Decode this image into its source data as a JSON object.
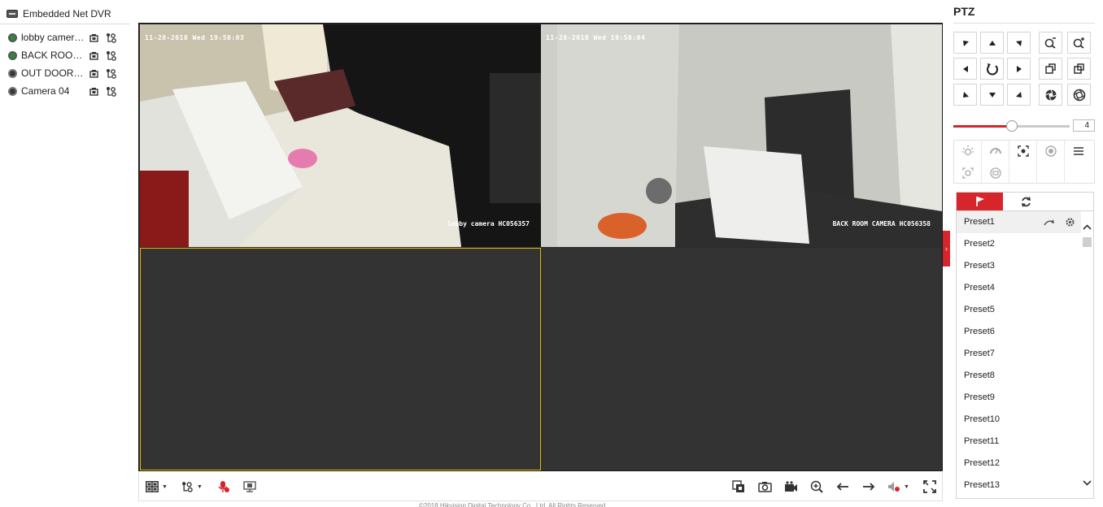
{
  "device": {
    "name": "Embedded Net DVR"
  },
  "cameras": [
    {
      "label": "lobby camera...",
      "live": true
    },
    {
      "label": "BACK ROOM...",
      "live": true
    },
    {
      "label": "OUT DOOR C...",
      "live": false
    },
    {
      "label": "Camera 04",
      "live": false
    }
  ],
  "video": {
    "tiles": [
      {
        "timestamp": "11-28-2018 Wed 19:50:03",
        "channel_name": "lobby camera HC056357"
      },
      {
        "timestamp": "11-28-2018 Wed 19:50:04",
        "channel_name": "BACK ROOM CAMERA HC056358"
      }
    ]
  },
  "ptz": {
    "title": "PTZ",
    "speed": "4",
    "speed_level": 0.5,
    "presets": [
      "Preset1",
      "Preset2",
      "Preset3",
      "Preset4",
      "Preset5",
      "Preset6",
      "Preset7",
      "Preset8",
      "Preset9",
      "Preset10",
      "Preset11",
      "Preset12",
      "Preset13"
    ],
    "selected_preset": "Preset1"
  },
  "footer": {
    "copyright": "©2018 Hikvision Digital Technology Co., Ltd. All Rights Reserved."
  },
  "colors": {
    "accent": "#d6262c",
    "selected_tile_border": "#e6b800"
  }
}
